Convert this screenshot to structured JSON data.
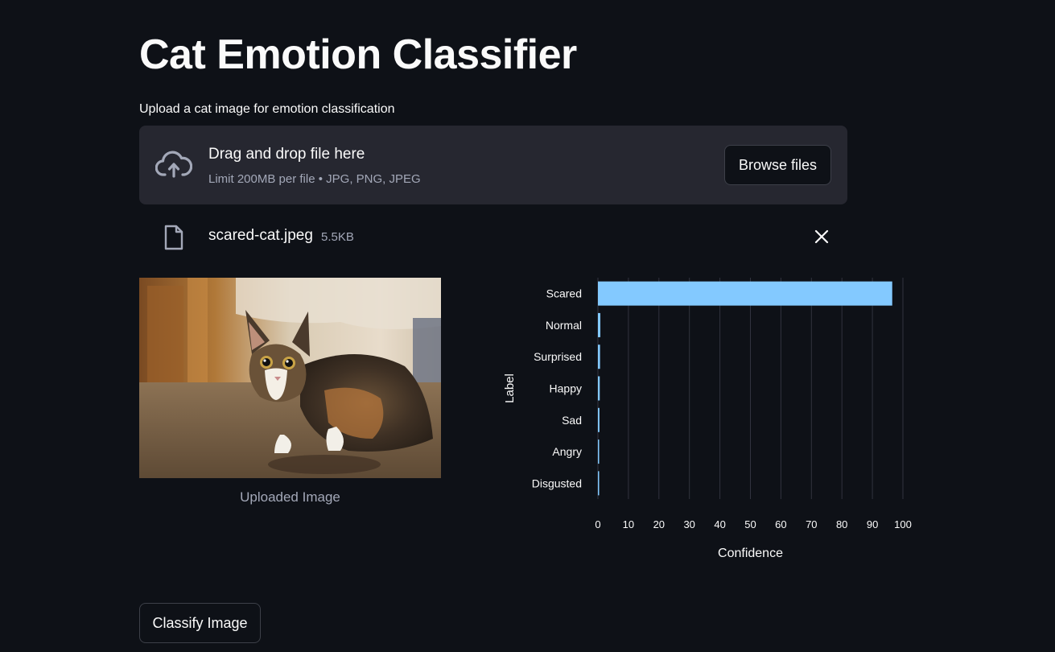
{
  "page": {
    "title": "Cat Emotion Classifier",
    "upload_label": "Upload a cat image for emotion classification"
  },
  "uploader": {
    "drag_text": "Drag and drop file here",
    "limit_text": "Limit 200MB per file • JPG, PNG, JPEG",
    "browse_label": "Browse files",
    "icon": "cloud-upload-icon"
  },
  "file": {
    "name": "scared-cat.jpeg",
    "size": "5.5KB",
    "icon": "file-icon",
    "remove_icon": "close-icon"
  },
  "image": {
    "caption": "Uploaded Image"
  },
  "chart_data": {
    "type": "bar",
    "orientation": "horizontal",
    "categories": [
      "Scared",
      "Normal",
      "Surprised",
      "Happy",
      "Sad",
      "Angry",
      "Disgusted"
    ],
    "values": [
      96.5,
      0.8,
      0.7,
      0.6,
      0.5,
      0.4,
      0.4
    ],
    "xlabel": "Confidence",
    "ylabel": "Label",
    "xlim": [
      0,
      100
    ],
    "xticks": [
      0,
      10,
      20,
      30,
      40,
      50,
      60,
      70,
      80,
      90,
      100
    ],
    "grid": true,
    "bar_color": "#83c9ff"
  },
  "actions": {
    "classify_label": "Classify Image"
  },
  "colors": {
    "background": "#0e1117",
    "surface": "#262730",
    "text": "#fafafa",
    "muted": "#a3a8b8",
    "bar": "#83c9ff"
  }
}
